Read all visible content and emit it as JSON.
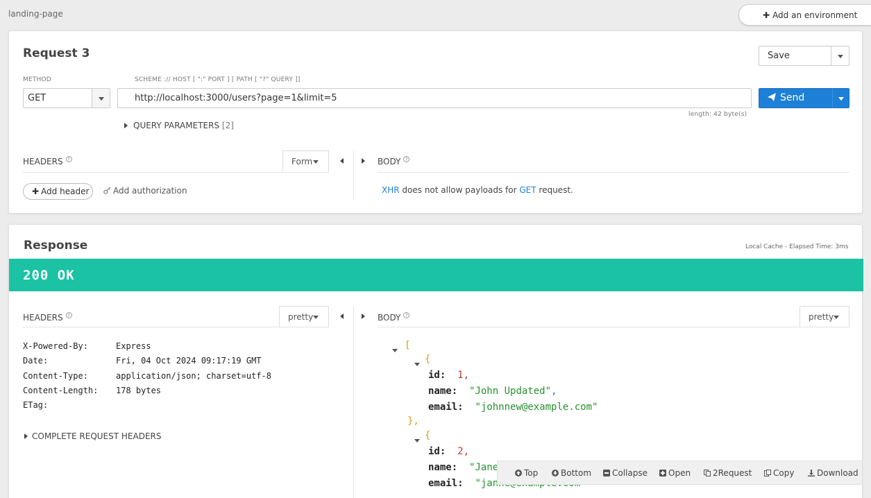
{
  "breadcrumb": "landing-page",
  "environment": {
    "add_label": "Add an environment"
  },
  "request": {
    "title": "Request 3",
    "save_label": "Save",
    "method_label": "METHOD",
    "method_value": "GET",
    "url_label": "SCHEME :// HOST [ \":\" PORT ] [ PATH [ \"?\" QUERY ]]",
    "url_value": "http://localhost:3000/users?page=1&limit=5",
    "length_text": "length: 42 byte(s)",
    "send_label": "Send",
    "query_params_label": "QUERY PARAMETERS",
    "query_params_count": "[2]",
    "headers_label": "HEADERS",
    "headers_mode": "Form",
    "add_header_label": "Add header",
    "add_auth_label": "Add authorization",
    "body_label": "BODY",
    "body_msg": {
      "xhr": "XHR",
      "mid": " does not allow payloads for ",
      "method": "GET",
      "end": " request."
    }
  },
  "response": {
    "title": "Response",
    "meta": "Local Cache - Elapsed Time: 3ms",
    "status": "200 OK",
    "headers_label": "HEADERS",
    "headers_mode": "pretty",
    "body_label": "BODY",
    "body_mode": "pretty",
    "headers": [
      {
        "key": "X-Powered-By:",
        "value": "Express"
      },
      {
        "key": "Date:",
        "value": "Fri, 04 Oct 2024 09:17:19 GMT"
      },
      {
        "key": "Content-Type:",
        "value": "application/json; charset=utf-8"
      },
      {
        "key": "Content-Length:",
        "value": "178 bytes"
      },
      {
        "key": "ETag:",
        "value": ""
      }
    ],
    "complete_headers_label": "COMPLETE REQUEST HEADERS",
    "body": {
      "open_bracket": "[",
      "open_brace": "{",
      "close_brace_comma": "},",
      "items": [
        {
          "id_key": "id:",
          "id": "1,",
          "name_key": "name:",
          "name": "\"John Updated\",",
          "email_key": "email:",
          "email": "\"johnnew@example.com\""
        },
        {
          "id_key": "id:",
          "id": "2,",
          "name_key": "name:",
          "name": "\"Jane S",
          "email_key": "email:",
          "email": "\"janne@example.com"
        }
      ]
    },
    "toolbar": {
      "top": "Top",
      "bottom": "Bottom",
      "collapse": "Collapse",
      "open": "Open",
      "to_request": "2Request",
      "copy": "Copy",
      "download": "Download"
    }
  },
  "colors": {
    "accent": "#1e7fd6",
    "status_ok": "#1bc2a3"
  }
}
